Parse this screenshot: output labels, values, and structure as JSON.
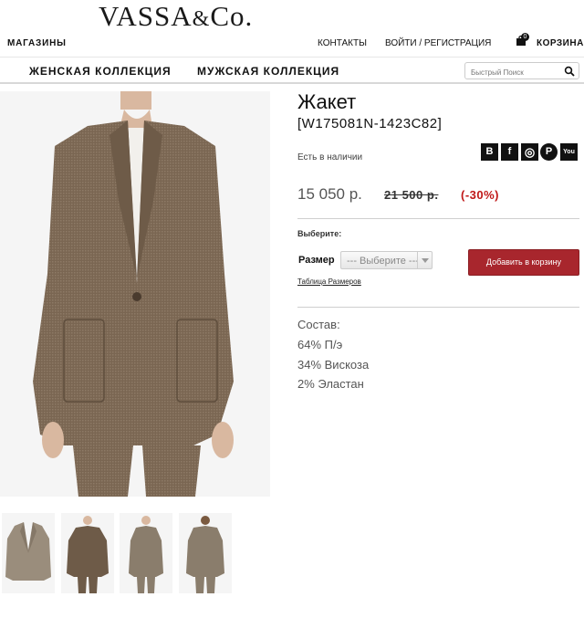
{
  "header": {
    "logo_main": "VASSA",
    "logo_amp": "&",
    "logo_co": "Co.",
    "stores": "МАГАЗИНЫ",
    "contacts": "КОНТАКТЫ",
    "login": "ВОЙТИ / РЕГИСТРАЦИЯ",
    "cart_count": "0",
    "cart_label": "КОРЗИНА"
  },
  "nav": {
    "women": "ЖЕНСКАЯ КОЛЛЕКЦИЯ",
    "men": "МУЖСКАЯ КОЛЛЕКЦИЯ",
    "search_placeholder": "Быстрый Поиск"
  },
  "product": {
    "title": "Жакет",
    "sku": "[W175081N-1423C82]",
    "stock": "Есть в наличии",
    "price": "15 050 р.",
    "old_price": "21 500 р.",
    "discount": "(-30%)",
    "choose_label": "Выберите:",
    "size_label": "Размер",
    "size_value": "--- Выберите ---",
    "size_table": "Таблица Размеров",
    "add_to_cart": "Добавить в корзину",
    "composition_title": "Состав:",
    "composition": [
      "64% П/э",
      "34% Вискоза",
      "2% Эластан"
    ]
  },
  "social": {
    "vk": "B",
    "fb": "f",
    "ig": "◎",
    "pin": "P",
    "yt": "You"
  },
  "colors": {
    "accent_button": "#a8262d",
    "discount": "#c01818",
    "jacket_brown": "#7a6652"
  }
}
